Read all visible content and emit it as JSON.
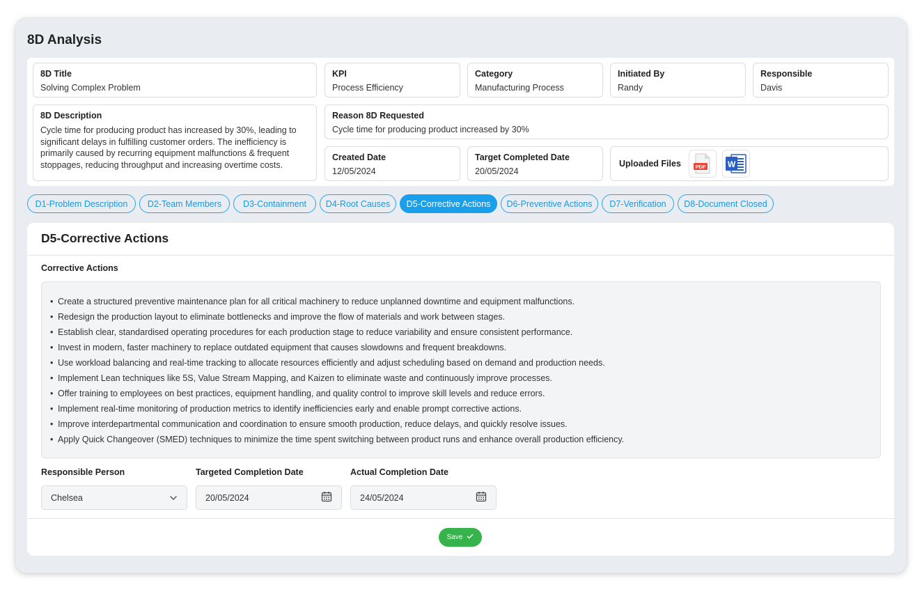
{
  "page": {
    "title": "8D Analysis"
  },
  "info": {
    "title": {
      "label": "8D Title",
      "value": "Solving Complex Problem"
    },
    "kpi": {
      "label": "KPI",
      "value": "Process Efficiency"
    },
    "category": {
      "label": "Category",
      "value": "Manufacturing Process"
    },
    "initiated_by": {
      "label": "Initiated By",
      "value": "Randy"
    },
    "responsible": {
      "label": "Responsible",
      "value": "Davis"
    },
    "description": {
      "label": "8D Description",
      "value": "Cycle time for producing product has increased by 30%, leading to significant delays in fulfilling customer orders. The inefficiency is primarily caused by recurring equipment malfunctions & frequent stoppages, reducing throughput and increasing overtime costs."
    },
    "reason": {
      "label": "Reason 8D Requested",
      "value": "Cycle time for producing product increased by 30%"
    },
    "created_date": {
      "label": "Created Date",
      "value": "12/05/2024"
    },
    "target_date": {
      "label": "Target Completed Date",
      "value": "20/05/2024"
    },
    "files": {
      "label": "Uploaded Files",
      "pdf_icon_text": "PDF",
      "word_icon_text": "W"
    }
  },
  "tabs": [
    {
      "label": "D1-Problem Description"
    },
    {
      "label": "D2-Team Members"
    },
    {
      "label": "D3-Containment"
    },
    {
      "label": "D4-Root Causes"
    },
    {
      "label": "D5-Corrective Actions"
    },
    {
      "label": "D6-Preventive Actions"
    },
    {
      "label": "D7-Verification"
    },
    {
      "label": "D8-Document Closed"
    }
  ],
  "active_tab": "D5-Corrective Actions",
  "panel": {
    "title": "D5-Corrective Actions",
    "section_label": "Corrective Actions",
    "actions": [
      "Create a structured preventive maintenance plan for all critical machinery to reduce unplanned downtime and equipment malfunctions.",
      "Redesign the production layout to eliminate bottlenecks and improve the flow of materials and work between stages.",
      "Establish clear, standardised operating procedures for each production stage to reduce variability and ensure consistent performance.",
      "Invest in modern, faster machinery to replace outdated equipment that causes slowdowns and frequent breakdowns.",
      "Use workload balancing and real-time tracking to allocate resources efficiently and adjust scheduling based on demand and production needs.",
      "Implement Lean techniques like 5S, Value Stream Mapping, and Kaizen to eliminate waste and continuously improve processes.",
      "Offer training to employees on best practices, equipment handling, and quality control to improve skill levels and reduce errors.",
      "Implement real-time monitoring of production metrics to identify inefficiencies early and enable prompt corrective actions.",
      "Improve interdepartmental communication and coordination to ensure smooth production, reduce delays, and quickly resolve issues.",
      "Apply Quick Changeover (SMED) techniques to minimize the time spent switching between product runs and enhance overall production efficiency."
    ],
    "responsible_person": {
      "label": "Responsible Person",
      "value": "Chelsea"
    },
    "targeted_completion": {
      "label": "Targeted Completion Date",
      "value": "20/05/2024"
    },
    "actual_completion": {
      "label": "Actual Completion Date",
      "value": "24/05/2024"
    },
    "save_label": "Save"
  },
  "colors": {
    "accent": "#1aa0ea",
    "save": "#36b34a",
    "pdf": "#e8463b",
    "word": "#2b5fc4",
    "window_bg": "#e9edf1"
  },
  "icons": {
    "pdf": "pdf-file-icon",
    "word": "word-file-icon",
    "dropdown": "chevron-down-icon",
    "calendar": "calendar-icon",
    "check": "check-icon"
  }
}
